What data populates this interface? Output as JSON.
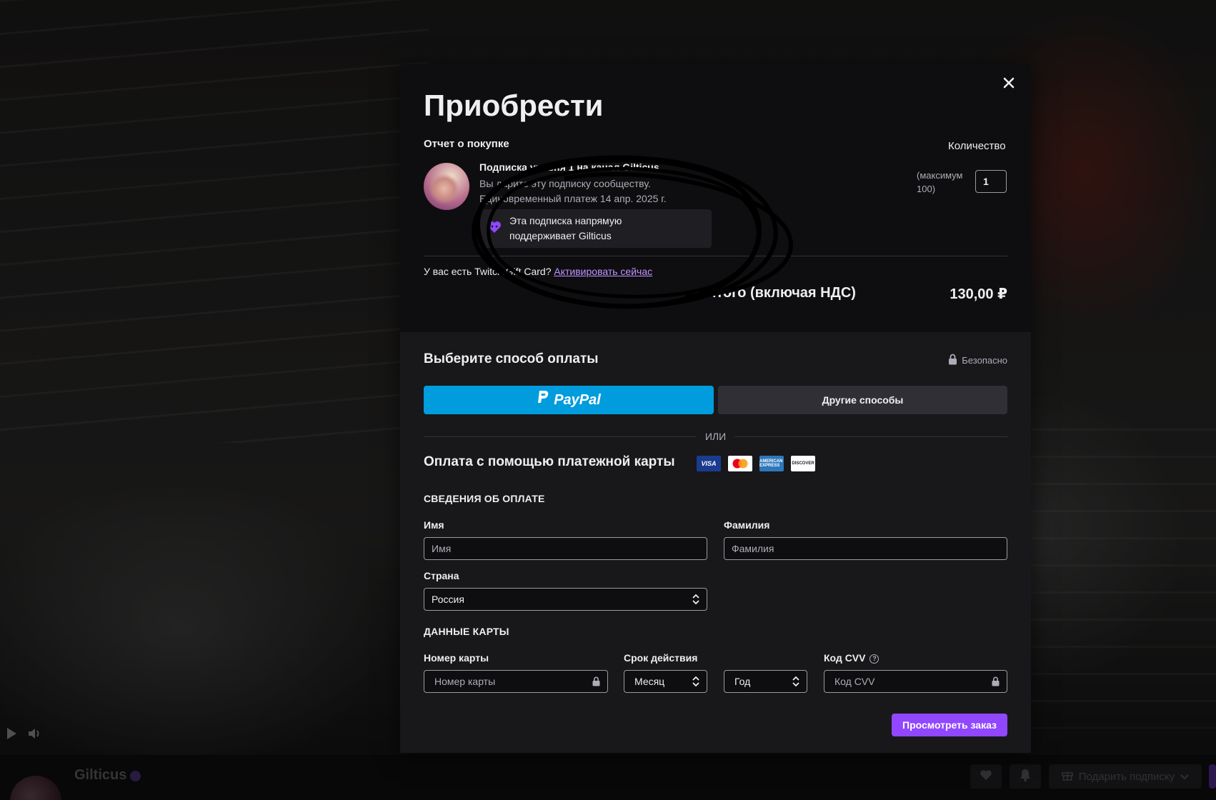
{
  "channel": {
    "name": "Gilticus",
    "gift_button_label": "Подарить подписку"
  },
  "modal": {
    "title": "Приобрести",
    "purchase_report_label": "Отчет о покупке",
    "quantity_label": "Количество",
    "item": {
      "title": "Подписка уровня 1 на канал Gilticus",
      "desc_line1": "Вы дарите эту подписку сообществу.",
      "desc_line2": "Единовременный платеж 14 апр. 2025 г.",
      "support_text": "Эта подписка напрямую поддерживает Gilticus"
    },
    "quantity": {
      "max_text": "(максимум 100)",
      "value": "1"
    },
    "gift_card": {
      "text": "У вас есть Twitch Gift Card?",
      "link": "Активировать сейчас"
    },
    "total": {
      "label": "Итого (включая НДС)",
      "value": "130,00 ₽"
    },
    "payment": {
      "title": "Выберите способ оплаты",
      "secure_label": "Безопасно",
      "paypal_label": "PayPal",
      "other_label": "Другие способы",
      "or_label": "ИЛИ",
      "card_title": "Оплата с помощью платежной карты",
      "card_logos": {
        "visa": "VISA",
        "amex": "AMERICAN EXPRESS",
        "discover": "DISCOVER"
      },
      "billing_header": "СВЕДЕНИЯ ОБ ОПЛАТЕ",
      "first_name_label": "Имя",
      "first_name_placeholder": "Имя",
      "last_name_label": "Фамилия",
      "last_name_placeholder": "Фамилия",
      "country_label": "Страна",
      "country_value": "Россия",
      "card_header": "ДАННЫЕ КАРТЫ",
      "card_number_label": "Номер карты",
      "card_number_placeholder": "Номер карты",
      "expiry_label": "Срок действия",
      "month_value": "Месяц",
      "year_value": "Год",
      "cvv_label": "Код CVV",
      "cvv_placeholder": "Код CVV",
      "review_button": "Просмотреть заказ"
    }
  },
  "colors": {
    "accent": "#9147ff",
    "paypal": "#009cde",
    "link": "#bf94ff"
  }
}
